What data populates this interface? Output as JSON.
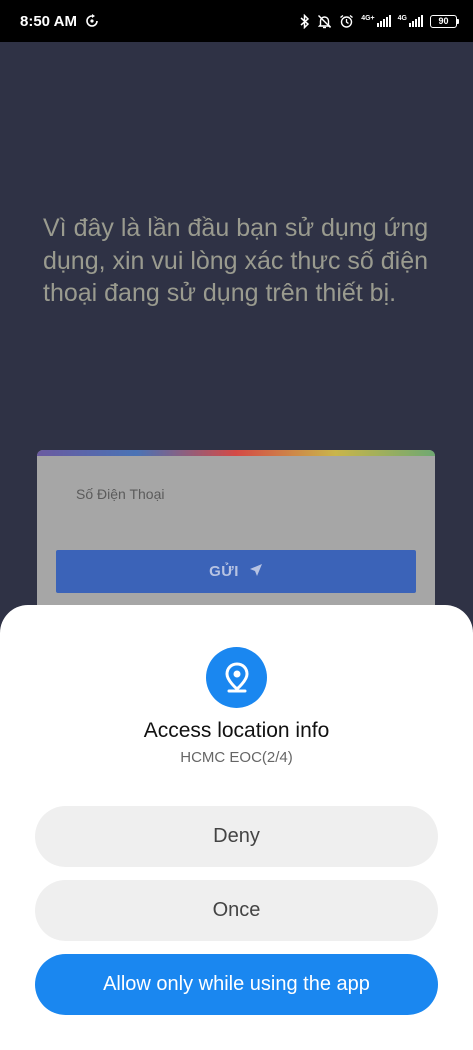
{
  "status_bar": {
    "time": "8:50 AM",
    "network_1": "4G+",
    "network_2": "4G",
    "battery": "90",
    "icons": [
      "sync-icon",
      "bluetooth-icon",
      "notifications-off-icon",
      "alarm-icon",
      "signal-icon",
      "signal-icon",
      "battery-icon"
    ]
  },
  "app": {
    "intro_text": "Vì đây là lần đầu bạn sử dụng ứng dụng, xin vui lòng xác thực số điện thoại đang sử dụng trên thiết bị.",
    "phone_placeholder": "Số Điện Thoại",
    "send_label": "GỬI",
    "send_icon": "send-icon"
  },
  "permission_dialog": {
    "icon": "location-pin-icon",
    "title": "Access location info",
    "subtitle": "HCMC EOC(2/4)",
    "deny_label": "Deny",
    "once_label": "Once",
    "allow_label": "Allow only while using the app",
    "accent_color": "#1a87f0"
  }
}
